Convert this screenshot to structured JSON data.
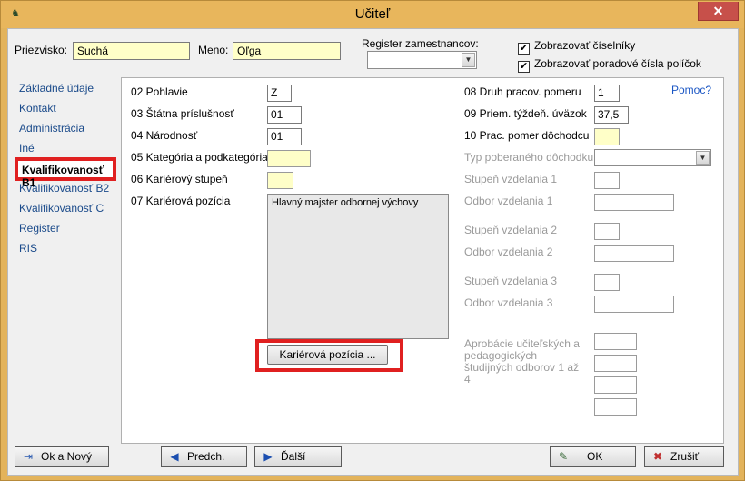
{
  "window": {
    "title": "Učiteľ",
    "close_glyph": "✕",
    "app_icon": "app-icon"
  },
  "header": {
    "surname_label": "Priezvisko:",
    "surname_value": "Suchá",
    "name_label": "Meno:",
    "name_value": "Oľga",
    "register_label": "Register zamestnancov:",
    "register_value": "",
    "show_codelists_label": "Zobrazovať číselníky",
    "show_codelists_checked": true,
    "show_field_numbers_label": "Zobrazovať poradové čísla políčok",
    "show_field_numbers_checked": true
  },
  "sidebar": {
    "items": [
      {
        "label": "Základné údaje",
        "active": false
      },
      {
        "label": "Kontakt",
        "active": false
      },
      {
        "label": "Administrácia",
        "active": false
      },
      {
        "label": "Iné",
        "active": false
      },
      {
        "label": "Kvalifikovanosť B1",
        "active": true
      },
      {
        "label": "Kvalifikovanosť B2",
        "active": false
      },
      {
        "label": "Kvalifikovanosť C",
        "active": false
      },
      {
        "label": "Register",
        "active": false
      },
      {
        "label": "RIS",
        "active": false
      }
    ]
  },
  "left_fields": {
    "gender_label": "02 Pohlavie",
    "gender_value": "Z",
    "citizenship_label": "03 Štátna príslušnosť",
    "citizenship_value": "01",
    "nationality_label": "04 Národnosť",
    "nationality_value": "01",
    "category_label": "05 Kategória a podkategória",
    "category_value": "",
    "career_level_label": "06 Kariérový stupeň",
    "career_level_value": "",
    "career_position_label": "07 Kariérová pozícia",
    "career_position_value": "Hlavný majster odbornej výchovy",
    "career_position_button": "Kariérová pozícia ..."
  },
  "right_fields": {
    "help_link": "Pomoc?",
    "employment_type_label": "08 Druh pracov. pomeru",
    "employment_type_value": "1",
    "weekly_hours_label": "09 Priem. týždeň. úväzok",
    "weekly_hours_value": "37,5",
    "pension_label": "10 Prac. pomer dôchodcu",
    "pension_value": "",
    "pension_type_label": "Typ poberaného dôchodku",
    "pension_type_value": "",
    "edu_level_1_label": "Stupeň vzdelania 1",
    "edu_field_1_label": "Odbor vzdelania 1",
    "edu_level_2_label": "Stupeň vzdelania 2",
    "edu_field_2_label": "Odbor vzdelania 2",
    "edu_level_3_label": "Stupeň vzdelania 3",
    "edu_field_3_label": "Odbor vzdelania 3",
    "approbation_label": "Aprobácie učiteľských a pedagogických študijných odborov 1 až 4"
  },
  "footer": {
    "ok_new_label": "Ok a Nový",
    "prev_label": "Predch.",
    "next_label": "Ďalší",
    "ok_label": "OK",
    "cancel_label": "Zrušiť"
  },
  "colors": {
    "title_bar": "#e8b65c",
    "highlight_frame": "#e02020",
    "required_field": "#ffffc8",
    "link": "#1a56c4"
  }
}
